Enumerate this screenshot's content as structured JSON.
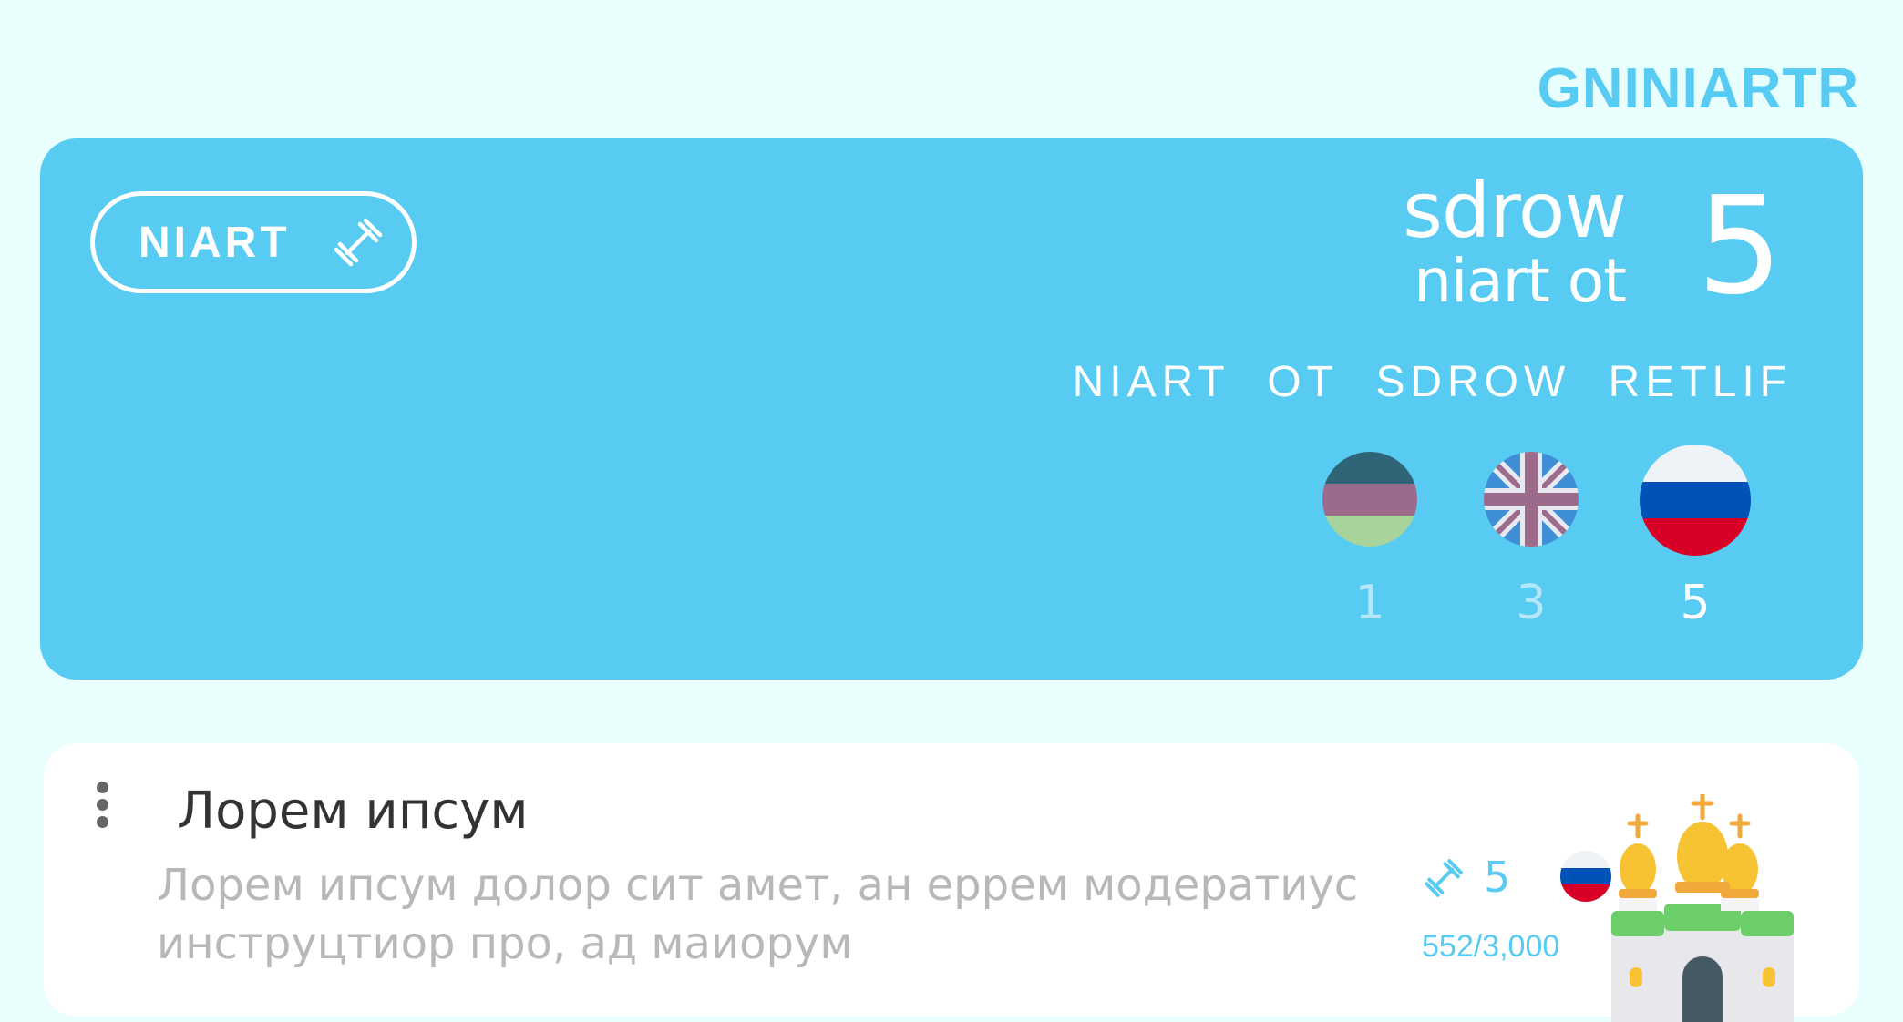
{
  "header": {
    "title": "GNINIARTR"
  },
  "hero": {
    "train_button": {
      "label": "NIART",
      "icon": "dumbbell-icon"
    },
    "words_to_train": {
      "line1": "sdrow",
      "line2": "niart ot",
      "count": "5"
    },
    "filter_label": "NIART OT SDROW RETLIF",
    "languages": [
      {
        "name": "german-flag",
        "count": "1",
        "selected": false
      },
      {
        "name": "uk-flag",
        "count": "3",
        "selected": false
      },
      {
        "name": "russia-flag",
        "count": "5",
        "selected": true
      }
    ]
  },
  "card": {
    "title": "Лорем ипсум",
    "description": "Лорем ипсум долор сит амет, ан еррем модератиус инструцтиор про, ад маиорум",
    "to_train_count": "5",
    "progress": "552/3,000",
    "flag": "russia-flag",
    "illustration": "cathedral-icon"
  },
  "colors": {
    "accent": "#57cbf2",
    "background": "#e8fffe",
    "card": "#ffffff"
  }
}
